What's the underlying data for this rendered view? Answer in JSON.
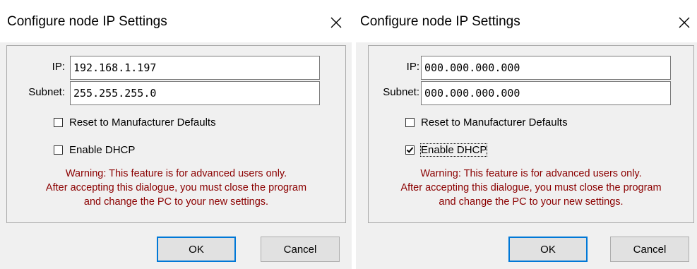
{
  "dialogs": [
    {
      "title": "Configure node IP Settings",
      "ip_label": "IP:",
      "ip_value": "192.168.1.197",
      "subnet_label": "Subnet:",
      "subnet_value": "255.255.255.0",
      "reset_label": "Reset to Manufacturer Defaults",
      "reset_checked": false,
      "dhcp_label": "Enable DHCP",
      "dhcp_checked": false,
      "warning": [
        "Warning: This feature is for advanced users only.",
        "After accepting this dialogue, you must close the program",
        "and change the PC to your new settings."
      ],
      "ok_label": "OK",
      "cancel_label": "Cancel"
    },
    {
      "title": "Configure node IP Settings",
      "ip_label": "IP:",
      "ip_value": "000.000.000.000",
      "subnet_label": "Subnet:",
      "subnet_value": "000.000.000.000",
      "reset_label": "Reset to Manufacturer Defaults",
      "reset_checked": false,
      "dhcp_label": "Enable DHCP",
      "dhcp_checked": true,
      "warning": [
        "Warning: This feature is for advanced users only.",
        "After accepting this dialogue, you must close the program",
        "and change the PC to your new settings."
      ],
      "ok_label": "OK",
      "cancel_label": "Cancel"
    }
  ],
  "colors": {
    "warning_text": "#8b0000",
    "dialog_bg": "#f0f0f0",
    "default_button_border": "#0078d7"
  },
  "icons": {
    "close": "close-icon",
    "checkmark": "checkmark-icon"
  }
}
